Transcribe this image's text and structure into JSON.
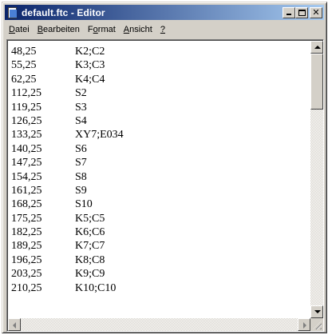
{
  "window": {
    "title": "default.ftc - Editor",
    "icon": "notepad-icon"
  },
  "menu": {
    "items": [
      {
        "accel": "D",
        "rest": "atei"
      },
      {
        "accel": "B",
        "rest": "earbeiten"
      },
      {
        "pre": "F",
        "accel": "o",
        "rest": "rmat"
      },
      {
        "accel": "A",
        "rest": "nsicht"
      },
      {
        "accel": "?",
        "rest": ""
      }
    ]
  },
  "editor": {
    "lines": [
      {
        "time": "48,25",
        "code": "K2;C2"
      },
      {
        "time": "55,25",
        "code": "K3;C3"
      },
      {
        "time": "62,25",
        "code": "K4;C4"
      },
      {
        "time": "112,25",
        "code": "S2"
      },
      {
        "time": "119,25",
        "code": "S3"
      },
      {
        "time": "126,25",
        "code": "S4"
      },
      {
        "time": "133,25",
        "code": "XY7;E034"
      },
      {
        "time": "140,25",
        "code": "S6"
      },
      {
        "time": "147,25",
        "code": "S7"
      },
      {
        "time": "154,25",
        "code": "S8"
      },
      {
        "time": "161,25",
        "code": "S9"
      },
      {
        "time": "168,25",
        "code": "S10"
      },
      {
        "time": "175,25",
        "code": "K5;C5"
      },
      {
        "time": "182,25",
        "code": "K6;C6"
      },
      {
        "time": "189,25",
        "code": "K7;C7"
      },
      {
        "time": "196,25",
        "code": "K8;C8"
      },
      {
        "time": "203,25",
        "code": "K9;C9"
      },
      {
        "time": "210,25",
        "code": "K10;C10"
      }
    ]
  },
  "colors": {
    "title_active_start": "#0a246a",
    "title_active_end": "#a6caf0",
    "chrome": "#d4d0c8"
  }
}
